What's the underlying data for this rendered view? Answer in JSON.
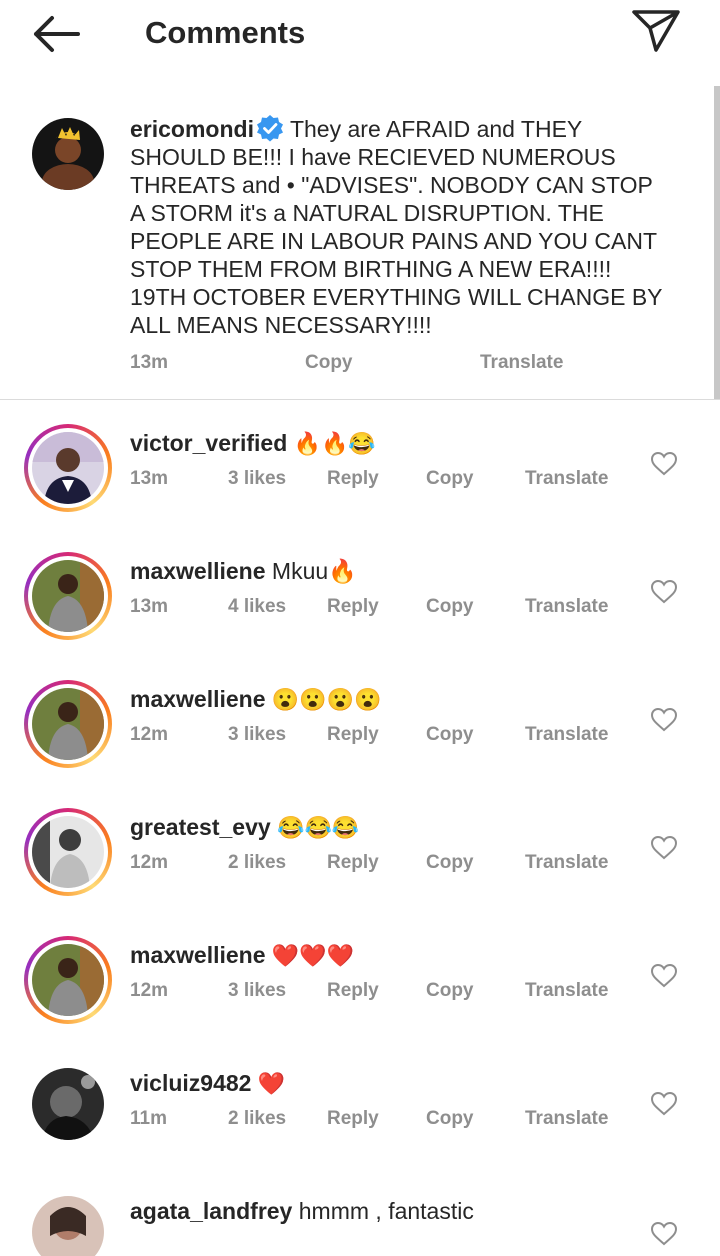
{
  "header": {
    "title": "Comments"
  },
  "caption": {
    "username": "ericomondi",
    "text": "They are AFRAID and THEY SHOULD BE!!! I have RECIEVED NUMEROUS THREATS and • \"ADVISES\". NOBODY CAN STOP A STORM it's a NATURAL DISRUPTION. THE PEOPLE ARE IN LABOUR PAINS AND YOU CANT STOP THEM FROM BIRTHING A NEW ERA!!!! 19TH OCTOBER EVERYTHING WILL CHANGE BY ALL MEANS NECESSARY!!!!",
    "time": "13m",
    "copy": "Copy",
    "translate": "Translate"
  },
  "comments": [
    {
      "username": "victor_verified",
      "text": "🔥🔥😂",
      "time": "13m",
      "likes": "3 likes",
      "reply": "Reply",
      "copy": "Copy",
      "translate": "Translate"
    },
    {
      "username": "maxwelliene",
      "text": "Mkuu🔥",
      "time": "13m",
      "likes": "4 likes",
      "reply": "Reply",
      "copy": "Copy",
      "translate": "Translate"
    },
    {
      "username": "maxwelliene",
      "text": "😮😮😮😮",
      "time": "12m",
      "likes": "3 likes",
      "reply": "Reply",
      "copy": "Copy",
      "translate": "Translate"
    },
    {
      "username": "greatest_evy",
      "text": "😂😂😂",
      "time": "12m",
      "likes": "2 likes",
      "reply": "Reply",
      "copy": "Copy",
      "translate": "Translate"
    },
    {
      "username": "maxwelliene",
      "text": "❤️❤️❤️",
      "time": "12m",
      "likes": "3 likes",
      "reply": "Reply",
      "copy": "Copy",
      "translate": "Translate"
    },
    {
      "username": "vicluiz9482",
      "text": "❤️",
      "time": "11m",
      "likes": "2 likes",
      "reply": "Reply",
      "copy": "Copy",
      "translate": "Translate"
    },
    {
      "username": "agata_landfrey",
      "text": "hmmm , fantastic"
    }
  ],
  "icons": {
    "back": "arrow-left-icon",
    "share": "paper-plane-icon",
    "verified": "verified-badge-icon",
    "like": "heart-outline-icon"
  },
  "colors": {
    "verified": "#3897f0",
    "meta": "#8e8e8e",
    "text": "#262626"
  }
}
